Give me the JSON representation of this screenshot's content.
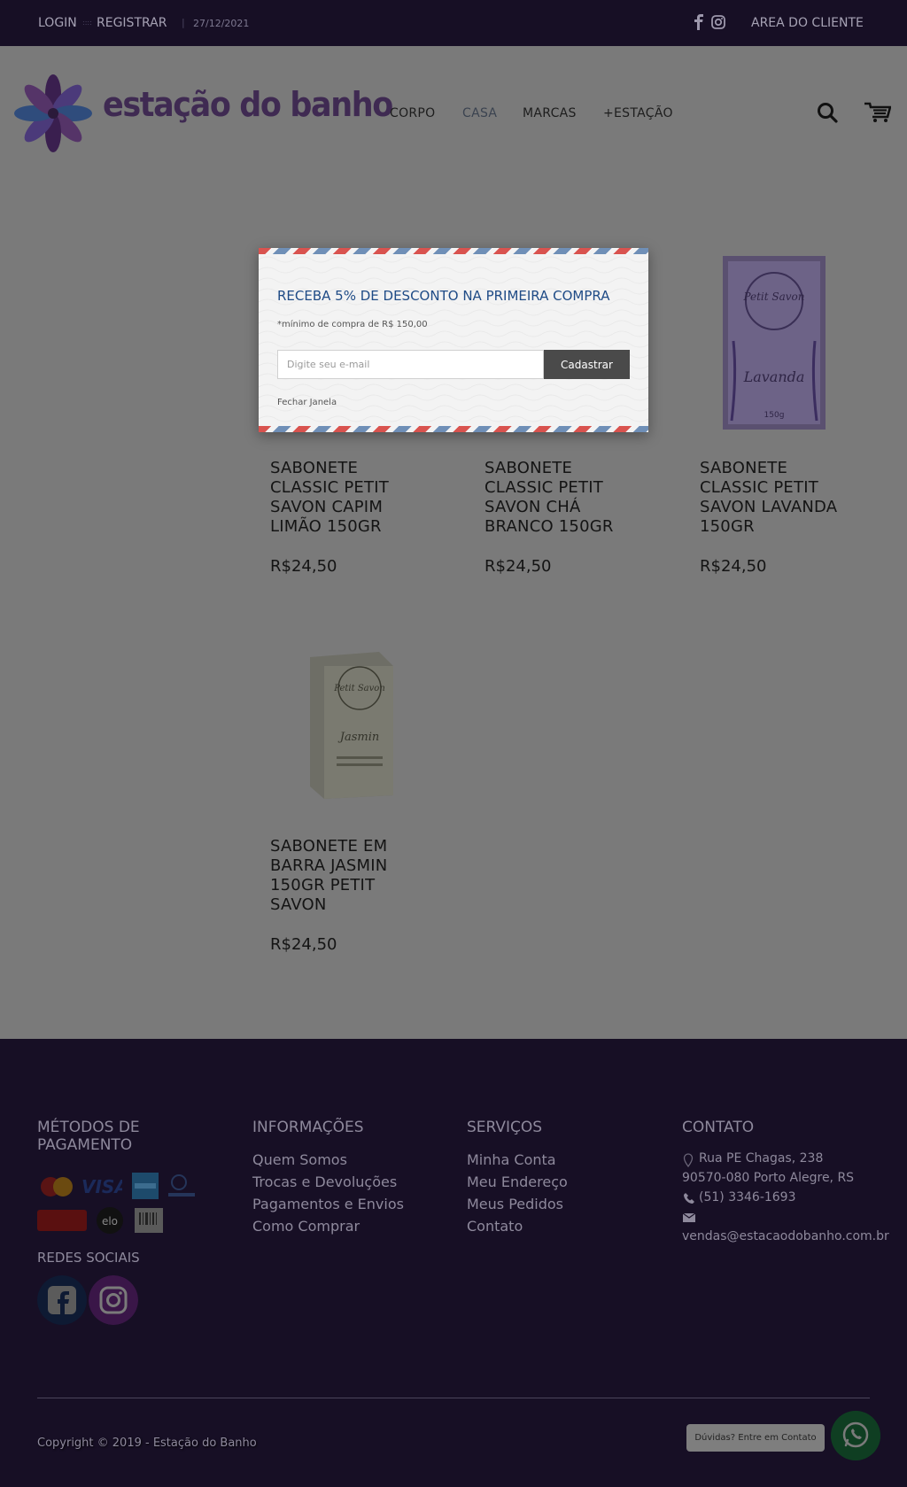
{
  "topbar": {
    "login": "LOGIN",
    "register": "REGISTRAR",
    "date": "27/12/2021",
    "area": "AREA DO CLIENTE"
  },
  "header": {
    "logo_text": "estação do banho",
    "nav": [
      "CORPO",
      "CASA",
      "MARCAS",
      "+ESTAÇÃO"
    ]
  },
  "products": [
    {
      "title": "SABONETE CLASSIC PETIT SAVON CAPIM LIMÃO 150GR",
      "price": "R$24,50"
    },
    {
      "title": "SABONETE CLASSIC PETIT SAVON CHÁ BRANCO 150GR",
      "price": "R$24,50"
    },
    {
      "title": "SABONETE CLASSIC PETIT SAVON LAVANDA 150GR",
      "price": "R$24,50"
    },
    {
      "title": "SABONETE EM BARRA JASMIN 150GR PETIT SAVON",
      "price": "R$24,50"
    }
  ],
  "product_box_text": {
    "lavanda_brand": "Petit Savon",
    "lavanda_name": "Lavanda",
    "lavanda_weight": "150g",
    "jasmin_brand": "Petit Savon",
    "jasmin_name": "Jasmin"
  },
  "modal": {
    "title": "RECEBA 5% DE DESCONTO NA PRIMEIRA COMPRA",
    "minimum": "*mínimo de compra de R$ 150,00",
    "email_placeholder": "Digite seu e-mail",
    "submit": "Cadastrar",
    "close": "Fechar Janela"
  },
  "footer": {
    "payment_title": "MÉTODOS DE PAGAMENTO",
    "social_title": "REDES SOCIAIS",
    "info_title": "INFORMAÇÕES",
    "info_links": [
      "Quem Somos",
      "Trocas e Devoluções",
      "Pagamentos e Envios",
      "Como Comprar"
    ],
    "services_title": "SERVIÇOS",
    "services_links": [
      "Minha Conta",
      "Meu Endereço",
      "Meus Pedidos",
      "Contato"
    ],
    "contact_title": "CONTATO",
    "address_line1": "Rua PE Chagas, 238",
    "address_line2": "90570-080 Porto Alegre, RS",
    "phone": "(51) 3346-1693",
    "email": "vendas@estacaodobanho.com.br",
    "payment_methods": [
      "mastercard",
      "visa",
      "american-express",
      "diners-club",
      "hipercard",
      "elo",
      "boleto"
    ],
    "copyright": "Copyright © 2019 - Estação do Banho"
  },
  "whatsapp": {
    "bubble": "Dúvidas? Entre em Contato"
  },
  "colors": {
    "topbar_bg": "#170f25",
    "footer_bg": "#170f25",
    "overlay_bg": "#7a7a7a",
    "modal_title": "#1f4b86",
    "button_bg": "#4a4a4a"
  }
}
